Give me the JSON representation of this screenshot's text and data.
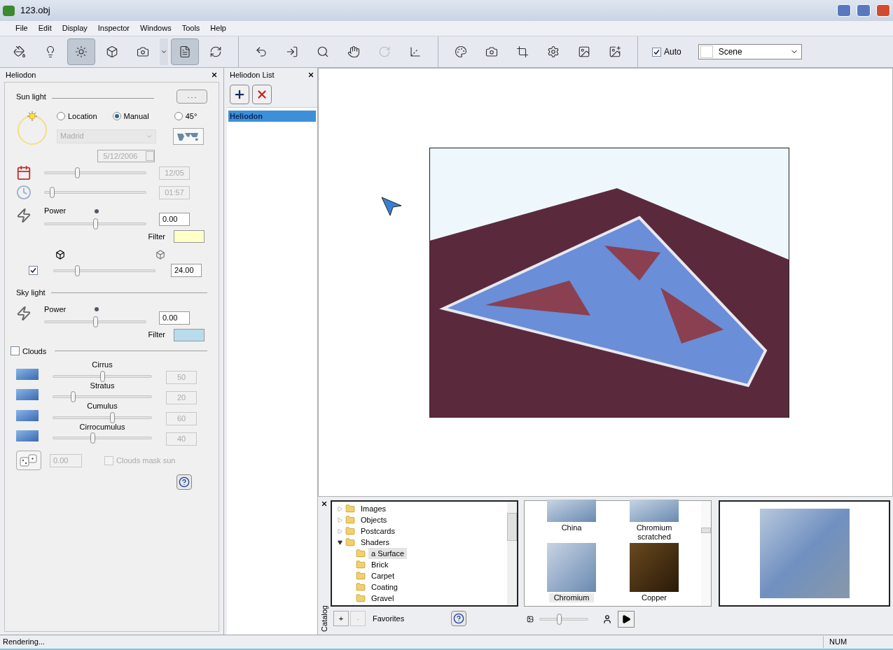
{
  "window": {
    "title": "123.obj"
  },
  "menu": [
    "File",
    "Edit",
    "Display",
    "Inspector",
    "Windows",
    "Tools",
    "Help"
  ],
  "toolbar": {
    "buttons": [
      {
        "selected": false
      },
      {
        "selected": false
      },
      {
        "selected": true
      },
      {
        "selected": false
      },
      {
        "selected": false
      },
      {
        "selected": true
      },
      {
        "selected": false
      },
      {
        "selected": false
      },
      {
        "selected": false
      },
      {
        "selected": false
      },
      {
        "selected": false
      },
      {
        "selected": false
      },
      {
        "selected": false
      },
      {
        "selected": false
      },
      {
        "selected": false
      },
      {
        "selected": false
      },
      {
        "selected": false
      },
      {
        "selected": false
      },
      {
        "selected": false
      }
    ],
    "auto": {
      "label": "Auto",
      "checked": true
    },
    "scene": {
      "value": "Scene"
    }
  },
  "heliodon": {
    "title": "Heliodon",
    "sun_light": {
      "title": "Sun light",
      "more_button": ". . .",
      "modes": [
        {
          "label": "Location",
          "selected": false
        },
        {
          "label": "Manual",
          "selected": true
        },
        {
          "label": "45°",
          "selected": false
        }
      ],
      "location": {
        "value": "Madrid",
        "disabled": true
      },
      "date": {
        "value": "5/12/2006",
        "disabled": true
      },
      "day": {
        "level": 0.32,
        "value": "12/05",
        "disabled": true
      },
      "time": {
        "level": 0.07,
        "value": "01:57",
        "disabled": true
      },
      "power": {
        "label": "Power",
        "level": 0.5,
        "value": "0.00"
      },
      "filter": {
        "label": "Filter",
        "color": "#ffffc8"
      },
      "shadow": {
        "checked": true,
        "level": 0.23,
        "value": "24.00"
      }
    },
    "sky_light": {
      "title": "Sky light",
      "power": {
        "label": "Power",
        "level": 0.5,
        "value": "0.00"
      },
      "filter": {
        "label": "Filter",
        "color": "#b9dcec"
      }
    },
    "clouds": {
      "label": "Clouds",
      "checked": false,
      "layers": [
        {
          "name": "Cirrus",
          "level": 0.5,
          "value": "50",
          "disabled": true
        },
        {
          "name": "Stratus",
          "level": 0.2,
          "value": "20",
          "disabled": true
        },
        {
          "name": "Cumulus",
          "level": 0.6,
          "value": "60",
          "disabled": true
        },
        {
          "name": "Cirrocumulus",
          "level": 0.4,
          "value": "40",
          "disabled": true
        }
      ],
      "seed": "0.00",
      "mask_sun": {
        "label": "Clouds mask sun",
        "checked": false
      }
    }
  },
  "heliodon_list": {
    "title": "Heliodon List",
    "items": [
      {
        "label": "Heliodon",
        "selected": true
      }
    ]
  },
  "catalog": {
    "label": "Catalog",
    "tree": [
      {
        "label": "Images",
        "expanded": false,
        "selected": false
      },
      {
        "label": "Objects",
        "expanded": false,
        "selected": false
      },
      {
        "label": "Postcards",
        "expanded": false,
        "selected": false
      },
      {
        "label": "Shaders",
        "expanded": true,
        "selected": false,
        "children": [
          {
            "label": "a Surface",
            "selected": true
          },
          {
            "label": "Brick",
            "selected": false
          },
          {
            "label": "Carpet",
            "selected": false
          },
          {
            "label": "Coating",
            "selected": false
          },
          {
            "label": "Gravel",
            "selected": false
          }
        ]
      }
    ],
    "thumbnails": [
      {
        "label": "China",
        "selected": false
      },
      {
        "label": "Chromium scratched",
        "selected": false
      },
      {
        "label": "Chromium",
        "selected": true
      },
      {
        "label": "Copper",
        "selected": false
      }
    ],
    "favorites": {
      "label": "Favorites",
      "add": "+",
      "remove": "-"
    },
    "size_slider": {
      "level": 0.4
    }
  },
  "status_bar": {
    "message": "Rendering...",
    "num": "NUM"
  }
}
